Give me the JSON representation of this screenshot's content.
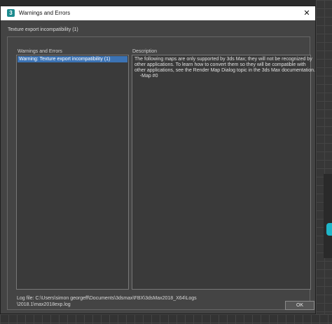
{
  "window": {
    "title": "Warnings and Errors",
    "close_glyph": "✕",
    "icon": "3ds-max-app-icon",
    "icon_glyph": "3"
  },
  "header": {
    "label": "Texture export incompatibility (1)"
  },
  "list": {
    "label": "Warnings and Errors",
    "items": [
      "Warning: Texture export incompatibility (1)"
    ]
  },
  "description": {
    "label": "Description",
    "lines": [
      "The following maps are only supported by 3ds Max; they will not be recognized by",
      "other applications. To learn how to convert them so they will be compatible with",
      "other applications, see the Render Map Dialog topic in the 3ds Max documentation.",
      "    -Map #0"
    ]
  },
  "log": {
    "line1": "Log file: C:\\Users\\simon georgeff\\Documents\\3dsmax\\FBX\\3dsMax2018_X64\\Logs",
    "line2": "\\2018.1\\max2018exp.log"
  },
  "buttons": {
    "ok_label": "OK"
  },
  "colors": {
    "selection": "#3c73b4",
    "dialog_bg": "#444444",
    "accent_cyan": "#1fb6c9"
  }
}
